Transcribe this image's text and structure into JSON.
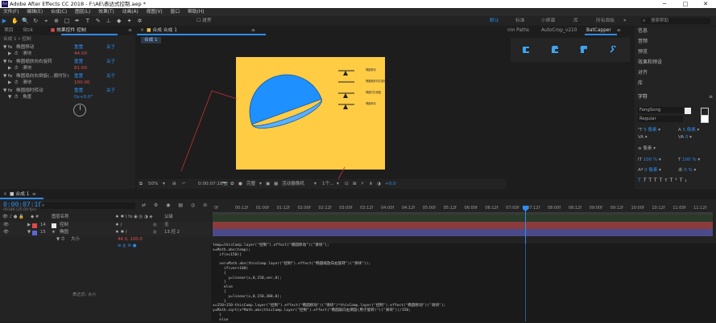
{
  "window": {
    "title": "Adobe After Effects CC 2018 - F:\\AE\\表达式控制.aep *",
    "app_icon": "Ae",
    "minimize": "─",
    "maximize": "□",
    "close": "✕"
  },
  "menu": [
    "文件(F)",
    "编辑(E)",
    "合成(C)",
    "图层(L)",
    "效果(T)",
    "动画(A)",
    "视图(V)",
    "窗口",
    "帮助(H)"
  ],
  "toolbar": {
    "snap_label": "对齐",
    "workspaces": [
      "默认",
      "标准",
      "小屏幕",
      "库",
      "所有面板"
    ],
    "search_placeholder": "搜索帮助"
  },
  "left_panel": {
    "tabs": [
      "项目",
      "Stck",
      "效果控件 控制"
    ],
    "breadcrumb": "合成 1 • 控制",
    "effects": [
      {
        "name": "椭圆移动",
        "reset": "重置",
        "about": "关于",
        "param": "滑块",
        "value": "44.00"
      },
      {
        "name": "椭圆缩放向右旋转",
        "reset": "重置",
        "about": "关于",
        "param": "滑块",
        "value": "81.00"
      },
      {
        "name": "椭圆扇向右倒旋(...顺时针)",
        "reset": "重置",
        "about": "关于",
        "param": "滑块",
        "value": "100.00"
      },
      {
        "name": "椭圆顺时转动",
        "reset": "重置",
        "about": "关于",
        "param": "角度",
        "value": "0x+0.0°"
      }
    ]
  },
  "comp_panel": {
    "tab": "合成 合成 1",
    "breadcrumb": "合成 1",
    "zoom": "50%",
    "timecode": "0:00:07:18",
    "quality": "完整",
    "camera": "活动摄像机",
    "views": "1个...",
    "exposure": "+0.0",
    "legend": [
      "椭圆移动",
      "椭圆缩放向右旋转",
      "椭圆向右倒旋",
      "椭圆转动"
    ]
  },
  "effects_panel": {
    "tabs": [
      "nm Paths",
      "AutoCrop_v210",
      "BatCapper"
    ],
    "icons": [
      "cap-a-icon",
      "cap-b-icon",
      "cap-c-icon",
      "wrench-icon"
    ]
  },
  "right_panel": {
    "items": [
      "信息",
      "音频",
      "预览",
      "效果和预设",
      "对齐",
      "库"
    ],
    "character": {
      "title": "字符",
      "font": "FangSong",
      "style": "Regular",
      "size": "5 像素",
      "leading": "5 像素",
      "tracking": "0",
      "stroke": "像素",
      "vscale": "100 %",
      "hscale": "100 %",
      "baseline": "0 像素",
      "tsume": "0 %",
      "styles": [
        "T",
        "T",
        "TT",
        "Tт",
        "T¹",
        "T₁"
      ]
    }
  },
  "timeline": {
    "tab": "合成 1",
    "timecode": "0:00:07:18",
    "frames": "00186 (25.00 fps)",
    "search_placeholder": "",
    "columns": [
      "图层名称",
      "父级"
    ],
    "layers": [
      {
        "num": "14",
        "name": "控制",
        "color": "#e04848",
        "parent": "无"
      },
      {
        "num": "15",
        "name": "椭圆",
        "color": "#5a66d8",
        "parent": "13.控 2"
      }
    ],
    "property": {
      "name": "大小",
      "value": "44.0, 100.0"
    },
    "expression_label": "表达式: 大小",
    "ruler": [
      "0f",
      "00:12f",
      "01:00f",
      "01:12f",
      "02:00f",
      "02:12f",
      "03:00f",
      "03:12f",
      "04:00f",
      "04:12f",
      "05:00f",
      "05:12f",
      "06:00f",
      "06:12f",
      "07:00f",
      "07:12f",
      "08:00f",
      "08:12f",
      "09:00f",
      "09:12f",
      "10:00f",
      "10:12f",
      "11:00f",
      "11:12f"
    ],
    "code": [
      "temp=thisComp.layer(\"控制\").effect(\"椭圆移动\")(\"滑块\");",
      "x=Math.abs(temp);",
      "   if(x<150){",
      "",
      "   ver=Math.abs(thisComp.layer(\"控制\").effect(\"椭圆缩放向右旋转\")(\"滑块\"));",
      "     if(ver<100)",
      "     {",
      "       y=linear(x,0,150,ver,0);",
      "     }",
      "     else",
      "     {",
      "       y=linear(x,0,150,300,0);",
      "     }",
      "x=150+150-thisComp.layer(\"控制\").effect(\"椭圆移动\")(\"滑块\")*thisComp.layer(\"控制\").effect(\"椭圆移动\")(\"滑块\");",
      "y=Math.sqrt(x*Math.abs(thisComp.layer(\"控制\").effect(\"椭圆扇向右倒旋(用于旋转)\")(\"滑块\"))/150;",
      "   }",
      "   else"
    ]
  }
}
